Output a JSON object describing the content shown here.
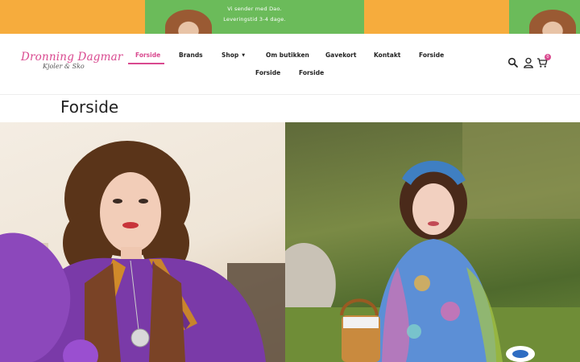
{
  "banner": {
    "line1": "Vi sender med Dao.",
    "line2": "Leveringstid 3-4 dage."
  },
  "logo": {
    "title": "Dronning Dagmar",
    "subtitle": "Kjoler & Sko"
  },
  "nav": {
    "items": [
      {
        "label": "Forside",
        "active": true
      },
      {
        "label": "Brands"
      },
      {
        "label": "Shop",
        "has_dropdown": true
      },
      {
        "label": "Om butikken"
      },
      {
        "label": "Gavekort"
      },
      {
        "label": "Kontakt"
      },
      {
        "label": "Forside"
      },
      {
        "label": "Forside"
      },
      {
        "label": "Forside"
      }
    ]
  },
  "header_icons": {
    "search": "search-icon",
    "account": "user-icon",
    "cart": "cart-icon",
    "cart_count": "0"
  },
  "page": {
    "title": "Forside"
  },
  "colors": {
    "accent": "#d9498f",
    "banner_orange": "#f6ac3d",
    "banner_green": "#6bbb5a"
  }
}
